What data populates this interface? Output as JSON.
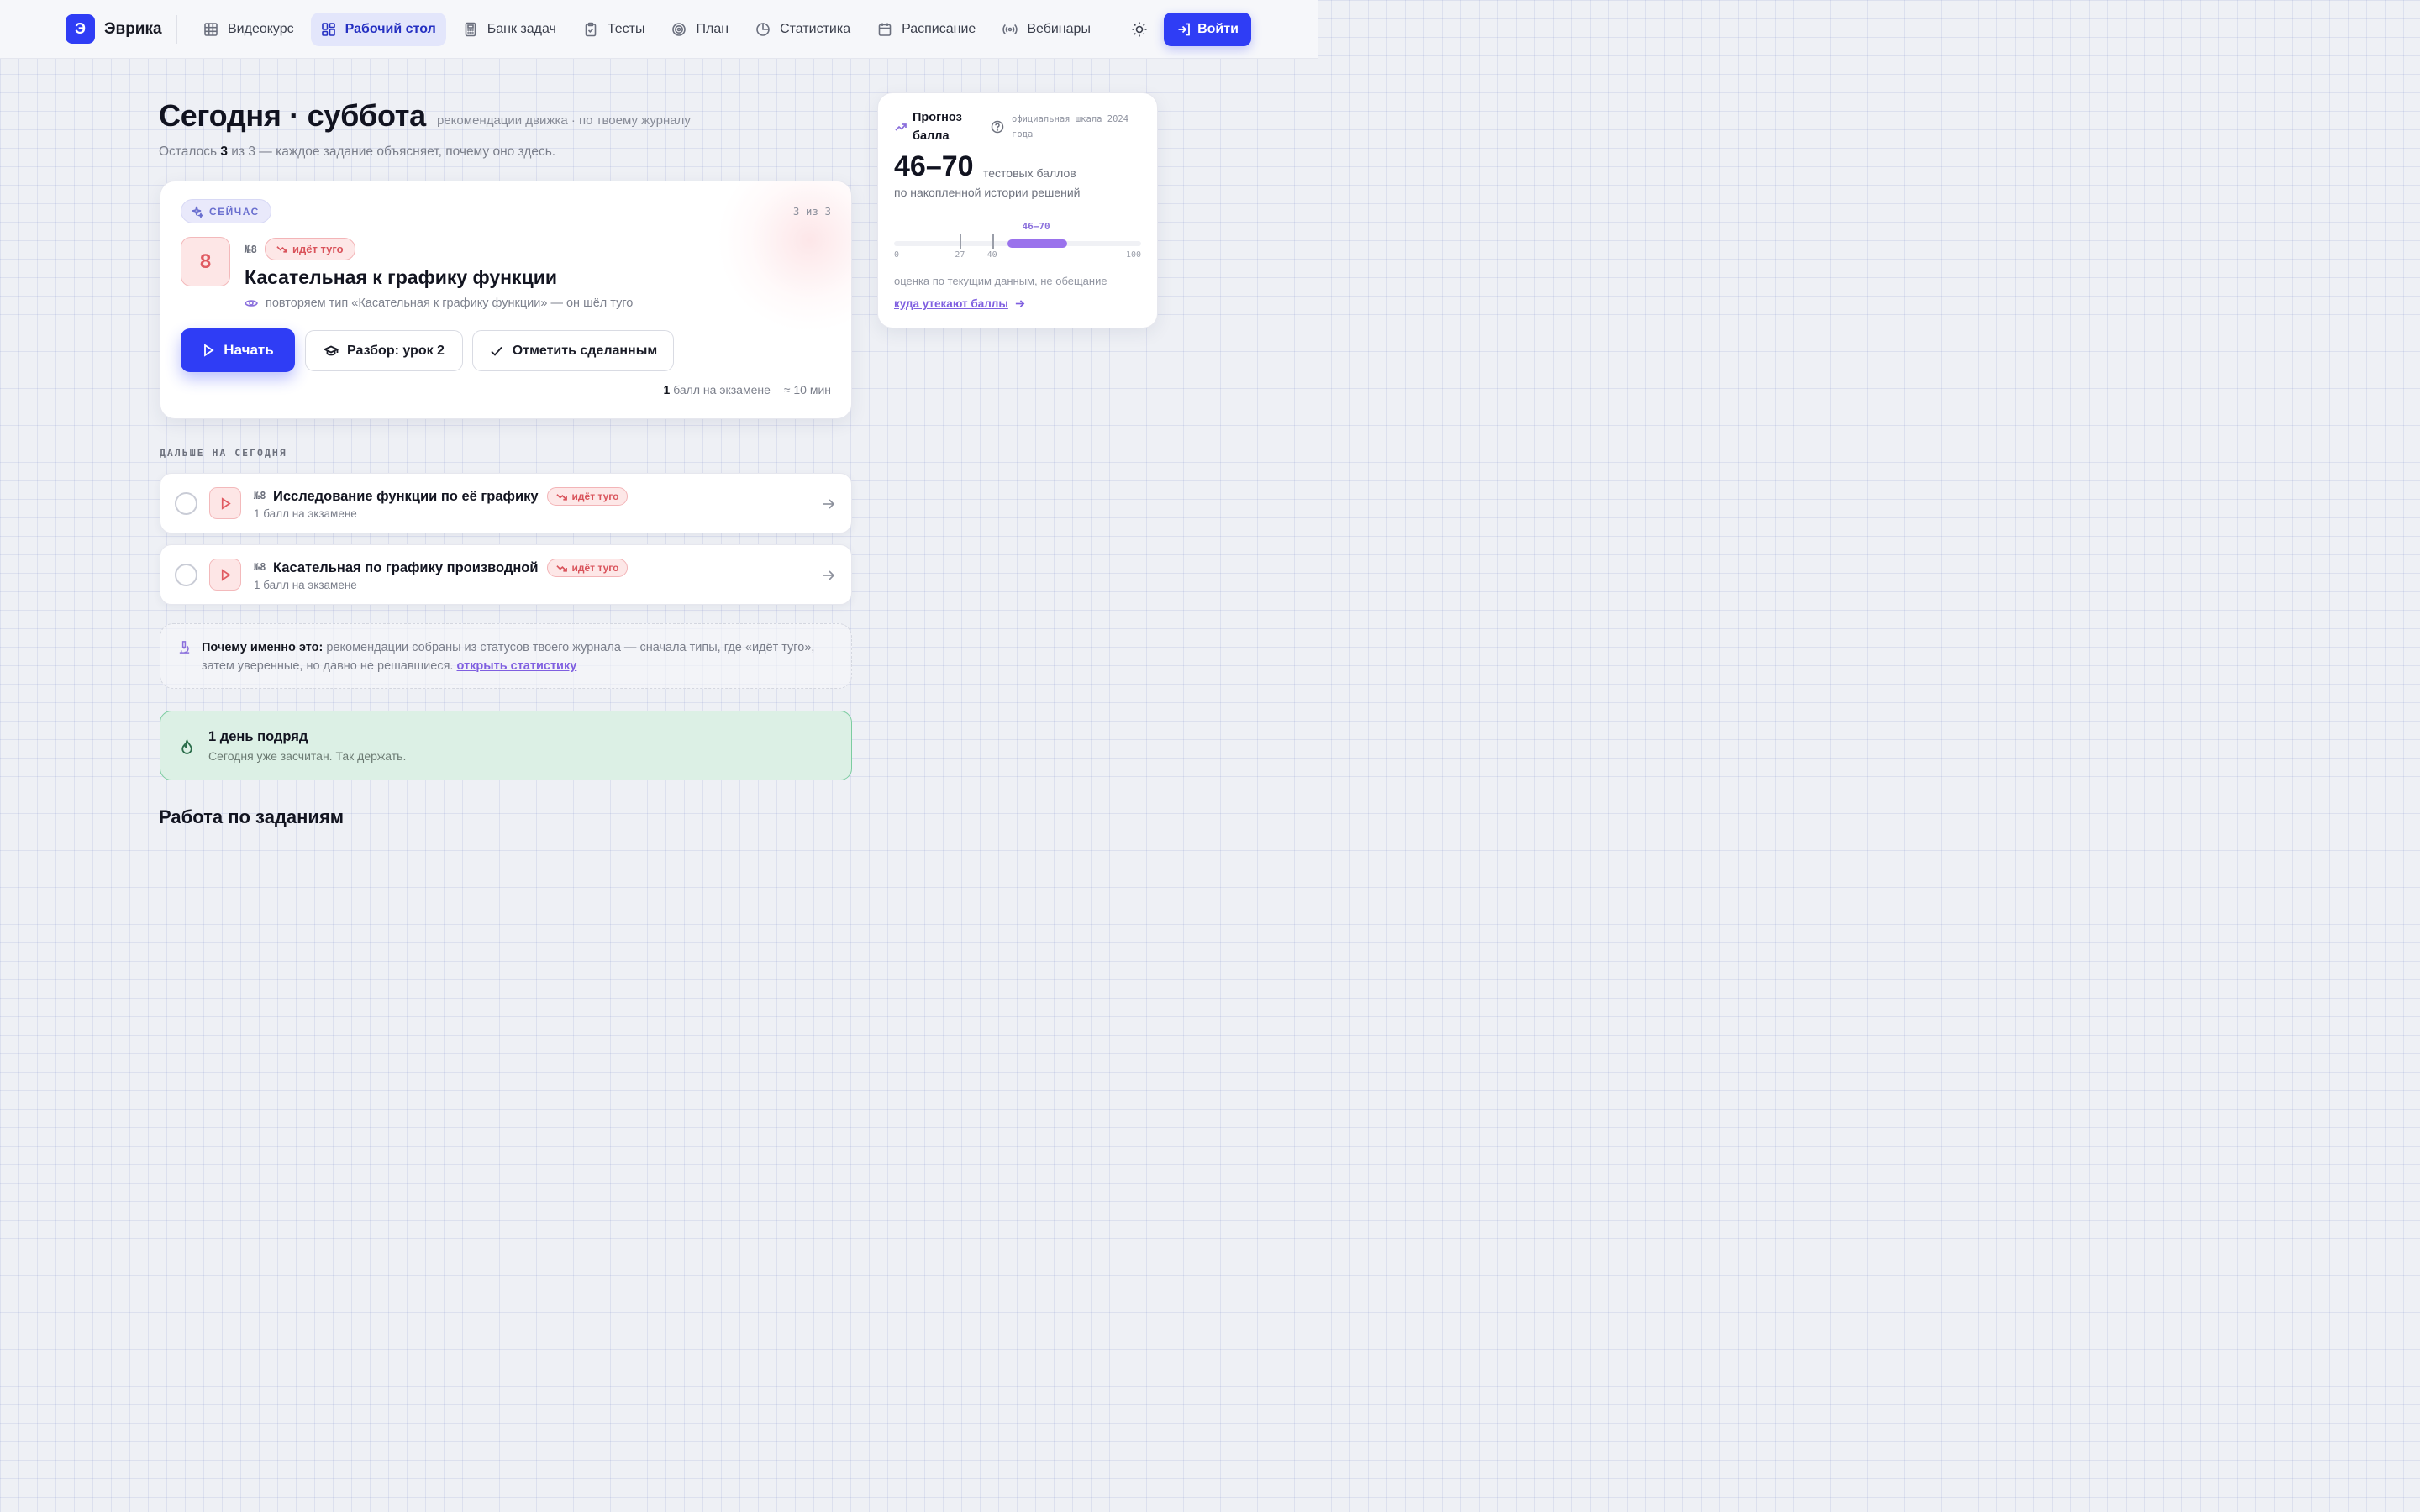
{
  "brand": {
    "logo_letter": "Э",
    "name": "Эврика"
  },
  "nav": {
    "items": [
      {
        "label": "Видеокурс",
        "icon": "grid-icon",
        "active": false
      },
      {
        "label": "Рабочий стол",
        "icon": "dashboard-icon",
        "active": true
      },
      {
        "label": "Банк задач",
        "icon": "calculator-icon",
        "active": false
      },
      {
        "label": "Тесты",
        "icon": "clipboard-check-icon",
        "active": false
      },
      {
        "label": "План",
        "icon": "target-icon",
        "active": false
      },
      {
        "label": "Статистика",
        "icon": "pie-chart-icon",
        "active": false
      },
      {
        "label": "Расписание",
        "icon": "calendar-icon",
        "active": false
      },
      {
        "label": "Вебинары",
        "icon": "broadcast-icon",
        "active": false
      }
    ],
    "theme_icon": "sun-icon",
    "login_label": "Войти"
  },
  "header": {
    "title": "Сегодня · суббота",
    "subtitle": "рекомендации движка · по твоему журналу",
    "remaining_prefix": "Осталось",
    "remaining_count": "3",
    "remaining_suffix": "из 3 — каждое задание объясняет, почему оно здесь."
  },
  "current": {
    "badge": "СЕЙЧАС",
    "counter": "3 из 3",
    "number": "8",
    "task_no": "№8",
    "status": "идёт туго",
    "title": "Касательная к графику функции",
    "reason": "повторяем тип «Касательная к графику функции» — он шёл туго",
    "start_label": "Начать",
    "review_label": "Разбор: урок 2",
    "done_label": "Отметить сделанным",
    "points_value": "1",
    "points_label": "балл на экзамене",
    "time": "≈ 10 мин",
    "accent_color": "#e05a61"
  },
  "next": {
    "caption": "ДАЛЬШЕ НА СЕГОДНЯ",
    "items": [
      {
        "no": "№8",
        "title": "Исследование функции по её графику",
        "status": "идёт туго",
        "sub": "1 балл на экзамене"
      },
      {
        "no": "№8",
        "title": "Касательная по графику производной",
        "status": "идёт туго",
        "sub": "1 балл на экзамене"
      }
    ]
  },
  "why": {
    "lead": "Почему именно это:",
    "text": "рекомендации собраны из статусов твоего журнала — сначала типы, где «идёт туго», затем уверенные, но давно не решавшиеся.",
    "link": "открыть статистику"
  },
  "streak": {
    "title": "1 день подряд",
    "sub": "Сегодня уже засчитан. Так держать.",
    "color": "#dcf0e5"
  },
  "work": {
    "title": "Работа по заданиям"
  },
  "forecast": {
    "title": "Прогноз балла",
    "note": "официальная шкала 2024 года",
    "range": "46–70",
    "unit": "тестовых баллов",
    "basis": "по накопленной истории решений",
    "scale": {
      "min": 0,
      "max": 100,
      "min_label": "0",
      "max_label": "100",
      "thresholds": [
        27,
        40
      ],
      "band": [
        46,
        70
      ],
      "band_label": "46–70"
    },
    "caveat": "оценка по текущим данным, не обещание",
    "link": "куда утекают баллы",
    "accent_color": "#9a72ec"
  }
}
